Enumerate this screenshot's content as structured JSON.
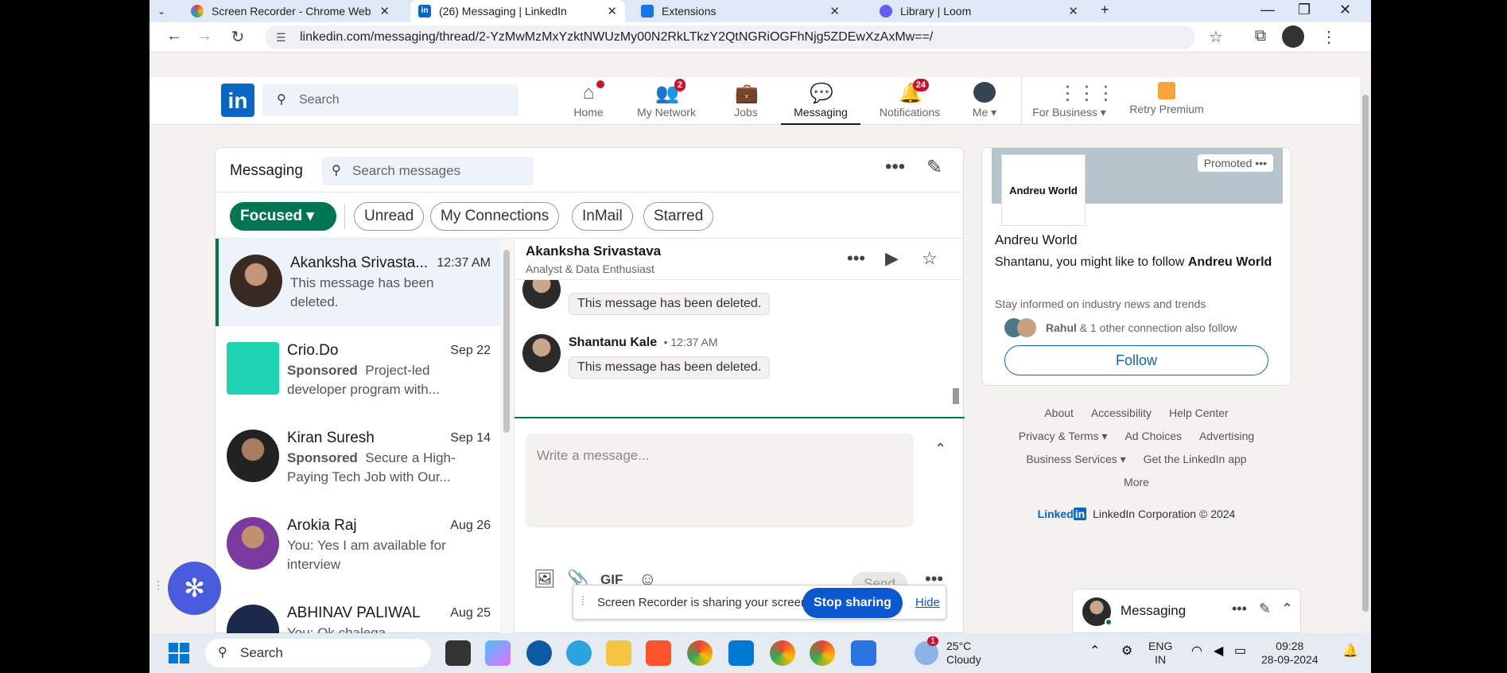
{
  "browser": {
    "tabs": [
      {
        "label": "Screen Recorder - Chrome Web",
        "icon": "rainbow-icon"
      },
      {
        "label": "(26) Messaging | LinkedIn",
        "icon": "linkedin-icon"
      },
      {
        "label": "Extensions",
        "icon": "puzzle-icon"
      },
      {
        "label": "Library | Loom",
        "icon": "loom-icon"
      }
    ],
    "url": "linkedin.com/messaging/thread/2-YzMwMzMxYzktNWUzMy00N2RkLTkzY2QtNGRiOGFhNjg5ZDEwXzAxMw==/"
  },
  "linkedin": {
    "logo": "in",
    "search_placeholder": "Search",
    "nav": [
      {
        "label": "Home",
        "icon": "home-icon",
        "badge": ""
      },
      {
        "label": "My Network",
        "icon": "people-icon",
        "badge": "2"
      },
      {
        "label": "Jobs",
        "icon": "briefcase-icon",
        "badge": ""
      },
      {
        "label": "Messaging",
        "icon": "chat-icon",
        "badge": ""
      },
      {
        "label": "Notifications",
        "icon": "bell-icon",
        "badge": "24"
      },
      {
        "label": "Me",
        "icon": "avatar-icon",
        "badge": ""
      },
      {
        "label": "For Business",
        "icon": "grid-icon",
        "badge": ""
      },
      {
        "label": "Retry Premium",
        "icon": "premium-icon",
        "badge": ""
      }
    ]
  },
  "messaging": {
    "title": "Messaging",
    "search_placeholder": "Search messages",
    "filters": [
      "Focused",
      "Unread",
      "My Connections",
      "InMail",
      "Starred"
    ],
    "conversations": [
      {
        "name": "Akanksha Srivasta...",
        "date": "12:37 AM",
        "sponsored": "",
        "preview": "This message has been deleted."
      },
      {
        "name": "Crio.Do",
        "date": "Sep 22",
        "sponsored": "Sponsored",
        "preview": "Project-led developer program with..."
      },
      {
        "name": "Kiran Suresh",
        "date": "Sep 14",
        "sponsored": "Sponsored",
        "preview": "Secure a High-Paying Tech Job with Our..."
      },
      {
        "name": "Arokia Raj",
        "date": "Aug 26",
        "sponsored": "",
        "preview": "You: Yes I am available for interview"
      },
      {
        "name": "ABHINAV PALIWAL",
        "date": "Aug 25",
        "sponsored": "",
        "preview": "You: Ok chalega"
      }
    ],
    "thread": {
      "name": "Akanksha Srivastava",
      "headline": "Analyst & Data Enthusiast",
      "messages": [
        {
          "sender": "Shantanu Kale",
          "time": "12:37 AM",
          "text": "This message has been deleted."
        },
        {
          "sender": "Shantanu Kale",
          "time": "12:37 AM",
          "text": "This message has been deleted."
        }
      ],
      "compose_placeholder": "Write a message...",
      "gif_label": "GIF",
      "send_label": "Send"
    }
  },
  "ad": {
    "promoted": "Promoted",
    "logo_text": "Andreu World",
    "name": "Andreu World",
    "text_prefix": "Shantanu, you might like to follow ",
    "text_bold": "Andreu World",
    "sub": "Stay informed on industry news and trends",
    "conn_bold": "Rahul",
    "conn_rest": " & 1 other connection also follow",
    "follow_label": "Follow"
  },
  "footer": {
    "links_row1": [
      "About",
      "Accessibility",
      "Help Center"
    ],
    "links_row2": [
      "Privacy & Terms ▾",
      "Ad Choices",
      "Advertising"
    ],
    "links_row3": [
      "Business Services ▾",
      "Get the LinkedIn app"
    ],
    "more": "More",
    "brand": "Linked",
    "copyright": "LinkedIn Corporation © 2024"
  },
  "mini_messaging": {
    "label": "Messaging"
  },
  "screen_share": {
    "text": "Screen Recorder is sharing your screen.",
    "stop": "Stop sharing",
    "hide": "Hide"
  },
  "taskbar": {
    "search": "Search",
    "weather_temp": "25°C",
    "weather_desc": "Cloudy",
    "weather_badge": "1",
    "lang1": "ENG",
    "lang2": "IN",
    "time": "09:28",
    "date": "28-09-2024"
  },
  "colors": {
    "linkedin_blue": "#0a66c2",
    "focused_green": "#01754f",
    "badge_red": "#cb112d"
  }
}
